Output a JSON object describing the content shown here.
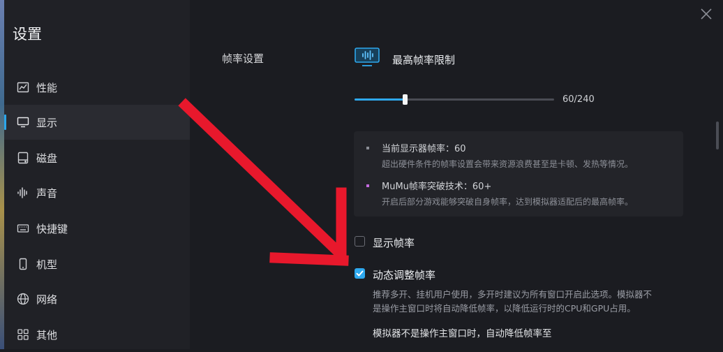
{
  "sidebar": {
    "title": "设置",
    "items": [
      {
        "label": "性能",
        "icon": "performance-chart-icon"
      },
      {
        "label": "显示",
        "icon": "monitor-icon",
        "active": true
      },
      {
        "label": "磁盘",
        "icon": "disk-icon"
      },
      {
        "label": "声音",
        "icon": "sound-wave-icon"
      },
      {
        "label": "快捷键",
        "icon": "keyboard-icon"
      },
      {
        "label": "机型",
        "icon": "phone-icon"
      },
      {
        "label": "网络",
        "icon": "globe-icon"
      },
      {
        "label": "其他",
        "icon": "grid-icon"
      }
    ]
  },
  "main": {
    "section_label": "帧率设置",
    "setting_title": "最高帧率限制",
    "slider": {
      "value": 60,
      "max": 240,
      "display": "60/240",
      "color": "#2ea8ee"
    },
    "info": [
      {
        "title": "当前显示器帧率：60",
        "desc": "超出硬件条件的帧率设置会带来资源浪费甚至是卡顿、发热等情况。",
        "bullet_color": "#8a8d95"
      },
      {
        "title": "MuMu帧率突破技术：60+",
        "desc": "开启后部分游戏能够突破自身帧率，达到模拟器适配后的最高帧率。",
        "bullet_color": "#c56be0"
      }
    ],
    "show_fps": {
      "label": "显示帧率",
      "checked": false
    },
    "dynamic_fps": {
      "label": "动态调整帧率",
      "checked": true,
      "desc_line1": "推荐多开、挂机用户使用，多开时建议为所有窗口开启此选项。模拟器不",
      "desc_line2": "是操作主窗口时将自动降低帧率，以降低运行时的CPU和GPU占用。"
    },
    "sub_label": "模拟器不是操作主窗口时，自动降低帧率至"
  },
  "colors": {
    "accent": "#2ea8ee",
    "arrow": "#e8182c"
  }
}
